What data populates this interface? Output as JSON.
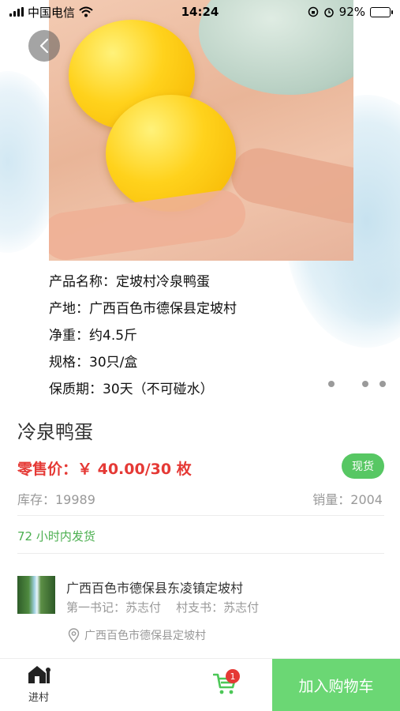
{
  "status_bar": {
    "carrier": "中国电信",
    "time": "14:24",
    "battery": "92%",
    "battery_level": 0.92,
    "icons": [
      "signal-icon",
      "wifi-icon",
      "orientation-lock-icon",
      "alarm-icon",
      "battery-icon"
    ]
  },
  "back_button": {
    "icon": "chevron-left-icon"
  },
  "gallery": {
    "specs": [
      "产品名称：定坡村冷泉鸭蛋",
      "产地：广西百色市德保县定坡村",
      "净重：约4.5斤",
      "规格：30只/盒",
      "保质期：30天（不可碰水）"
    ],
    "dots_count": 3
  },
  "product": {
    "title": "冷泉鸭蛋",
    "price": "零售价：￥ 40.00/30 枚",
    "badge": "现货",
    "stock": "库存：19989",
    "sales": "销量：2004",
    "shipping": "72 小时内发货"
  },
  "village": {
    "name": "广西百色市德保县东凌镇定坡村",
    "secretary": "第一书记：苏志付",
    "branch_secretary": "村支书：苏志付",
    "address": "广西百色市德保县定坡村"
  },
  "bottom_bar": {
    "village_tab": "进村",
    "cart_count": "1",
    "add_to_cart": "加入购物车"
  },
  "colors": {
    "price": "#e53935",
    "badge": "#57c763",
    "shipping": "#4caf50",
    "add_to_cart_bg": "#6bd774"
  }
}
